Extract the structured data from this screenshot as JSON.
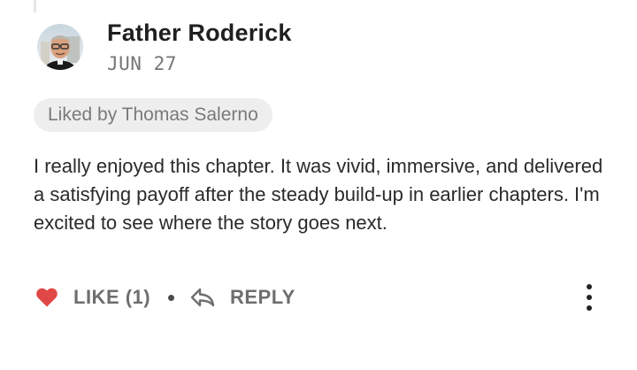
{
  "comment": {
    "author": "Father Roderick",
    "date": "JUN 27",
    "liked_by": "Liked by Thomas Salerno",
    "body": "I really enjoyed this chapter. It was vivid, immersive, and delivered a satisfying payoff after the steady build-up in earlier chapters. I'm excited to see where the story goes next.",
    "actions": {
      "like_label": "LIKE (1)",
      "reply_label": "REPLY"
    }
  },
  "icons": {
    "heart": "heart-icon",
    "reply": "reply-arrow-icon",
    "more": "more-vertical-icon"
  },
  "colors": {
    "heart": "#e04848",
    "action_text": "#6e6e6e",
    "pill_bg": "#eeeeee"
  }
}
